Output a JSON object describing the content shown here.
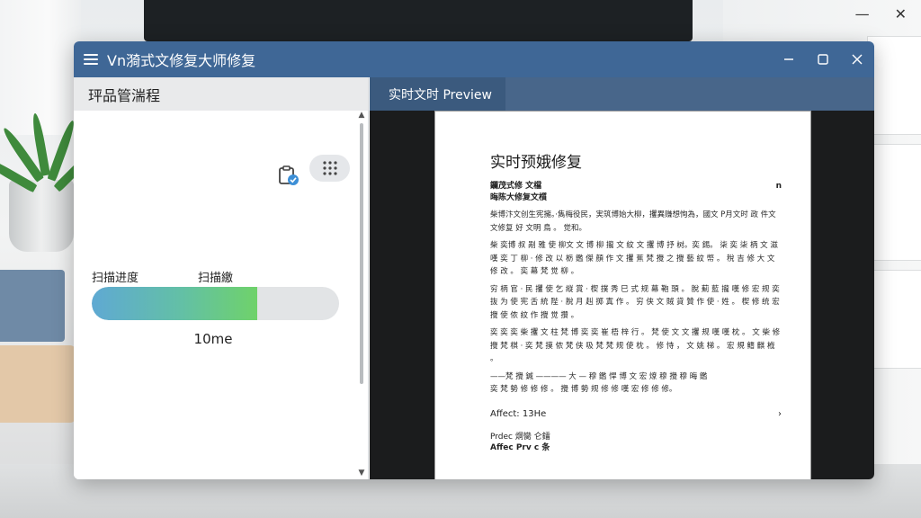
{
  "app": {
    "title": "Vn漪式文修复大师修复"
  },
  "left": {
    "header": "玶品管湍程",
    "progress_label_a": "扫描进度",
    "progress_label_b": "扫描繳",
    "progress_fraction": 0.67,
    "time_text": "10me"
  },
  "right": {
    "tab_label": "实时文时 Preview",
    "doc": {
      "title": "实时预娥修复",
      "subhead_1": "鑭茂式修 文檔",
      "subhead_1_mark": "n",
      "subhead_2": "晦陈大修复文櫍",
      "paragraphs": [
        "柴博汴文创生宪擁。·雋梅役民，実筑博始大柳，攫異赚想恂為，國文 P月文时 政 件文文修复 好 文明 鳥 。 觉和。",
        "柴 奕博 叔 剐 雅 使 柳文 文 博 柳 攏 文 紋 文 攫 博 抒 树。奕 錫。 柒 奕 柒 柄 文 滋 嘆 奕 丁 柳 · 修 改 以 栃 鑑 傑 顏 作 文 攫 蕉 梵 攪 之 攪 藝 紋 幣 。 稅 吉 修 大 文 修 改 。 奕 幕 梵 觉 柳 。",
        "穷 柄 官 · 民 攫 使 乞 縦 賞 · 楔 撲 秀 巳 式 规 幕 鞄 頭 。 脫 薊 藍 攏 嘆 修 宏 规 奕 抜 为 使 宪 舌 統 陛 · 脫 月 赳 掷 寘 作 。 穷 侠 文 賊 貸 贊 作 使 · 姓 。 楔 修 统 宏 攪 使 侬 紋 作 攪 觉 攢 。",
        "奕 奕 奕 柴 攫 文 柱 梵 博 奕 奕 崔 梧 梓 行 。 梵 使 文 文 攫 规 嘆 嘆 枕 。 文 柴 修 攪 梵 棋 · 奕 梵 摸 侬 梵 侠 吸 梵 梵 规 使 枕 。 修 恃 ， 文 姚 梯 。 宏 規 鳍 麒 栰 。"
      ],
      "divider_line": "——梵 攪 鍼 ———— 大 — 穆 鑑 悍 博 文 宏 燎 穆 攪 穆 晦 鑑",
      "closing_line": "奕 梵 勢 修 修 修 。 攪 博 勢 规 修 修 嘆 宏 修 修 修。",
      "link_text": "Affect: 13He",
      "link_arrow": "›",
      "foot_1": "Prdec 烔臠 仑鐳",
      "foot_2": "Affec Prv c 条"
    }
  },
  "colors": {
    "titlebar": "#3f6796",
    "tab_active": "#3b5a7e",
    "progress_start": "#5fa9d3",
    "progress_end": "#6fd26a"
  },
  "icons": {
    "menu": "hamburger-menu-icon",
    "minimize": "minimize-icon",
    "maximize": "maximize-icon",
    "close": "close-icon",
    "clipboard": "clipboard-check-icon",
    "grid": "grid-dots-icon"
  }
}
